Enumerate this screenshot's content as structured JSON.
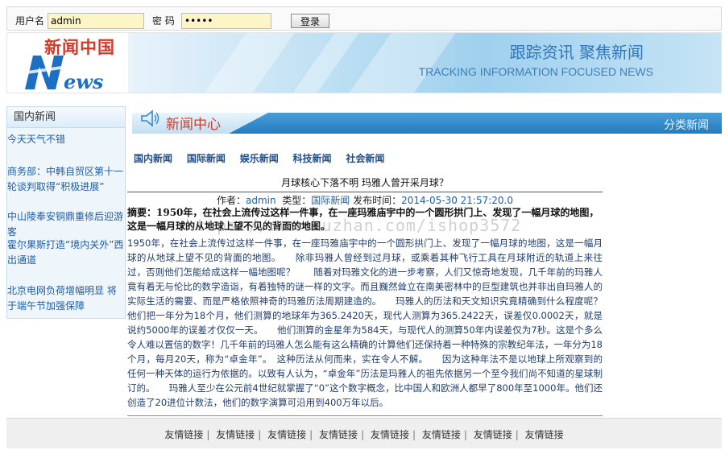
{
  "login": {
    "username_label": "用户名",
    "username_value": "admin",
    "password_label": "密  码",
    "password_value": "•••••",
    "login_button": "登录"
  },
  "banner": {
    "logo_cn": "新闻中国",
    "logo_en_rest": "ews",
    "slogan": "跟踪资讯 聚焦新闻",
    "slogan_en": "TRACKING INFORMATION FOCUSED NEWS"
  },
  "sidebar": {
    "title": "国内新闻",
    "items": [
      "今天天气不错",
      "商务部：中韩自贸区第十一轮谈判取得“积极进展”",
      "中山陵奉安铜鼎重修后迎游客",
      "霍尔果斯打造“境内关外”西出通道",
      "北京电网负荷增幅明显 将于端午节加强保障"
    ]
  },
  "center": {
    "title": "新闻中心",
    "more": "分类新闻"
  },
  "categories": [
    "国内新闻",
    "国际新闻",
    "娱乐新闻",
    "科技新闻",
    "社会新闻"
  ],
  "article": {
    "title": "月球核心下落不明 玛雅人曾开采月球？",
    "author_label": "作者：",
    "author": "admin",
    "type_label": "类型：",
    "type": "国际新闻",
    "time_label": "发布时间：",
    "time": "2014-05-30 21:57:20.0",
    "abstract": "摘要：1950年，在社会上流传过这样一件事，在一座玛雅庙宇中的一个圆形拱门上、发现了一幅月球的地图，这是一幅月球的从地球上望不见的背面的地图。",
    "body": "1950年，在社会上流传过这样一件事，在一座玛雅庙宇中的一个圆形拱门上、发现了一幅月球的地图，这是一幅月球的从地球上望不见的背面的地图。　　除非玛雅人曾经到过月球，或乘着其种飞行工具在月球附近的轨道上来往过，否则他们怎能给成这样一幅地图呢？　　随着对玛雅文化的进一步考察，人们又惊奇地发现，几千年前的玛雅人竟有着无与伦比的数学造诣，有着独特的谜一样的文字。而且巍然耸立在南美密林中的巨型建筑也并非出自玛雅人的实际生活的需要、而是严格依照神奇的玛雅历法周期建造的。　　玛雅人的历法和天文知识究竟精确到什么程度呢？他们把一年分为18个月，他们测算的地球年为365.2420天，现代人测算为365.2422天，误差仅0.0002天，就是说约5000年的误差才仅仅一天。　　他们测算的金星年为584天，与现代人的测算50年内误差仅为7秒。这是个多么令人难以置信的数字！几千年前的玛雅人怎么能有这么精确的计算他们还保持着一种特殊的宗教纪年法，一年分为18个月，每月20天，称为“卓金年”。　这种历法从何而来，实在令人不解。　　因为这种年法不是以地球上所观察到的任何一种天体的运行为依据的。以致有人认为，“卓金年”历法是玛雅人的祖先依据另一个至今我们尚不知道的星球制订的。　　玛雅人至少在公元前4世纪就掌握了“0”这个数字概念，比中国人和欧洲人都早了800年至1000年。他们还创造了20进位计数法，他们的数字演算可沿用到400万年以后。"
  },
  "watermark": "https://www.huzhan.com/ishop3572",
  "footer": {
    "links": [
      "友情链接",
      "友情链接",
      "友情链接",
      "友情链接",
      "友情链接",
      "友情链接",
      "友情链接",
      "友情链接"
    ]
  },
  "colors": {
    "accent_red": "#d23a2b",
    "link_blue": "#1d5da8",
    "banner_blue": "#237cc0"
  }
}
